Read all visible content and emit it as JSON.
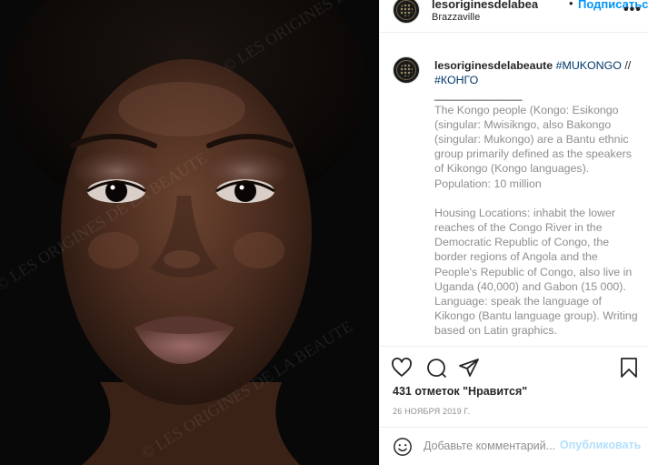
{
  "photo": {
    "watermark": "© LES ORIGINES DE LA BEAUTE"
  },
  "header": {
    "username": "lesoriginesdelabea",
    "separator": "•",
    "follow_label": "Подписаться",
    "location": "Brazzaville",
    "more_label": "•••"
  },
  "caption": {
    "author": "lesoriginesdelabeaute",
    "tag1": "#MUKONGO",
    "slash": " // ",
    "tag2": "#КОНГО",
    "rule": "______________",
    "paragraph1": "The Kongo people (Kongo: Esikongo (singular: Mwisikngo, also Bakongo (singular: Mukongo) are a Bantu ethnic group primarily defined as the speakers of Kikongo (Kongo languages). Population: 10 million",
    "paragraph2": "Housing Locations: inhabit the lower reaches of the Congo River in the Democratic Republic of Congo, the border regions of Angola and the People's Republic of Congo, also live in Uganda (40,000) and Gabon (15 000). Language: speak the language of Kikongo (Bantu language group). Writing based on Latin graphics."
  },
  "actions": {
    "like_icon": "heart-icon",
    "comment_icon": "comment-icon",
    "share_icon": "paper-plane-icon",
    "save_icon": "bookmark-icon"
  },
  "likes": "431 отметок \"Нравится\"",
  "date": "26 НОЯБРЯ 2019 Г.",
  "comment_box": {
    "placeholder": "Добавьте комментарий...",
    "publish_label": "Опубликовать"
  },
  "colors": {
    "link": "#0095f6",
    "hashtag": "#00376b",
    "muted": "#8e8e8e",
    "publish_disabled": "#b2dffc"
  }
}
